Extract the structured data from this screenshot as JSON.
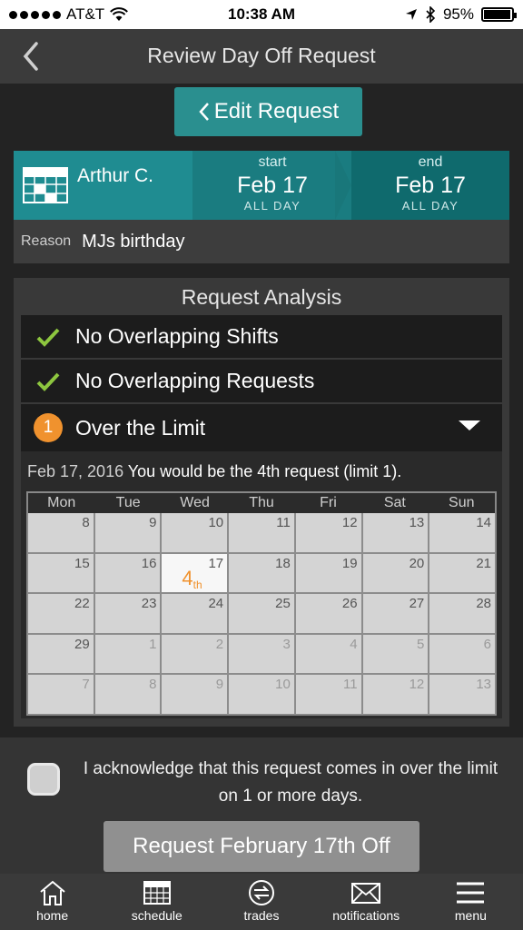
{
  "status_bar": {
    "carrier": "AT&T",
    "time": "10:38 AM",
    "battery": "95%",
    "battery_level": 0.95
  },
  "nav": {
    "title": "Review Day Off Request"
  },
  "edit_button": "Edit Request",
  "request": {
    "name": "Arthur C.",
    "start_label": "start",
    "start_date": "Feb 17",
    "start_sub": "ALL DAY",
    "end_label": "end",
    "end_date": "Feb 17",
    "end_sub": "ALL DAY",
    "reason_label": "Reason",
    "reason_value": "MJs birthday"
  },
  "analysis": {
    "heading": "Request Analysis",
    "rows": [
      {
        "icon": "check-icon",
        "text": "No Overlapping Shifts"
      },
      {
        "icon": "check-icon",
        "text": "No Overlapping Requests"
      },
      {
        "icon": "warning-badge",
        "badge": "1",
        "text": "Over the Limit"
      }
    ],
    "limit_date": "Feb 17, 2016",
    "limit_text": "You would be the 4th request (limit 1).",
    "weekdays": [
      "Mon",
      "Tue",
      "Wed",
      "Thu",
      "Fri",
      "Sat",
      "Sun"
    ],
    "weeks": [
      [
        "8",
        "9",
        "10",
        "11",
        "12",
        "13",
        "14"
      ],
      [
        "15",
        "16",
        "17",
        "18",
        "19",
        "20",
        "21"
      ],
      [
        "22",
        "23",
        "24",
        "25",
        "26",
        "27",
        "28"
      ],
      [
        "29",
        "1",
        "2",
        "3",
        "4",
        "5",
        "6"
      ],
      [
        "7",
        "8",
        "9",
        "10",
        "11",
        "12",
        "13"
      ]
    ],
    "marker_day": "17",
    "marker_num": "4",
    "marker_suffix": "th"
  },
  "acknowledge": {
    "text": "I acknowledge that this request comes in over the limit on 1 or more days.",
    "button": "Request February 17th Off"
  },
  "tabs": [
    {
      "label": "home",
      "icon": "home-icon"
    },
    {
      "label": "schedule",
      "icon": "calendar-icon"
    },
    {
      "label": "trades",
      "icon": "trades-icon"
    },
    {
      "label": "notifications",
      "icon": "envelope-icon"
    },
    {
      "label": "menu",
      "icon": "hamburger-icon"
    }
  ],
  "colors": {
    "teal": "#2a8f8f",
    "orange": "#f0922e",
    "check_green": "#8dc63f"
  }
}
